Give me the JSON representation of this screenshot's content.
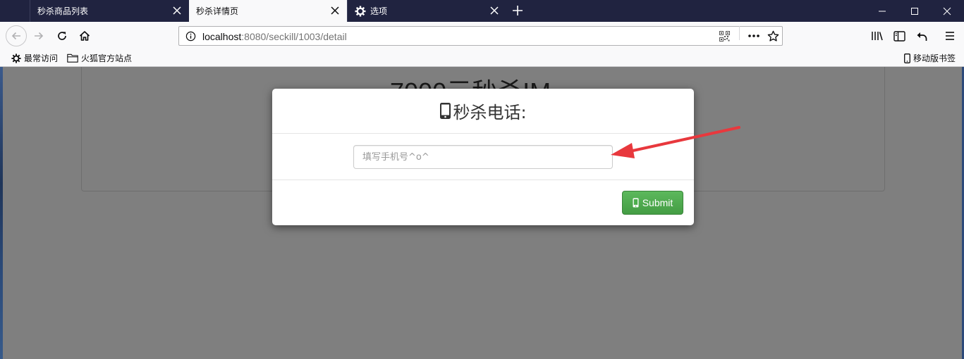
{
  "browser": {
    "tabs": [
      {
        "label": "秒杀商品列表",
        "active": false
      },
      {
        "label": "秒杀详情页",
        "active": true
      },
      {
        "label": "选项",
        "active": false,
        "icon": "gear-icon"
      }
    ],
    "url": {
      "host": "localhost",
      "path": ":8080/seckill/1003/detail"
    },
    "bookmarks": {
      "most_visited": "最常访问",
      "firefox_sites": "火狐官方站点",
      "mobile_bookmarks": "移动版书签"
    }
  },
  "page": {
    "heading_partial": "7000元秒杀IM"
  },
  "modal": {
    "title": "秒杀电话:",
    "title_icon": "mobile-phone-icon",
    "input_placeholder": "填写手机号^o^",
    "input_value": "",
    "submit_label": "Submit",
    "submit_color": "#5cb85c"
  },
  "annotation": {
    "arrow_color": "#e8383d"
  }
}
